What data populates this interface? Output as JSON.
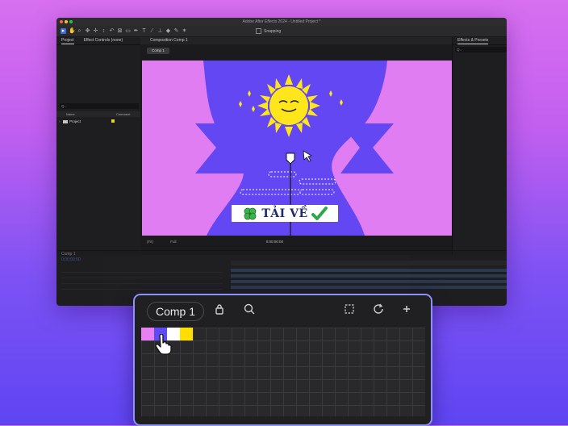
{
  "window": {
    "title": "Adobe After Effects 2024 - Untitled Project *"
  },
  "toolbar": {
    "snapping_label": "Snapping"
  },
  "project_panel": {
    "tabs": [
      "Project",
      "Effect Controls (none)"
    ],
    "search_placeholder": "Q⌵",
    "columns": {
      "name": "Name",
      "comment": "Comment"
    },
    "item": "Project"
  },
  "viewer": {
    "tab_label": "Composition Comp 1",
    "comp_pill": "Comp 1",
    "zoom": "(Fit)",
    "resolution": "Full",
    "timecode": "0:00:00:00"
  },
  "effects_panel": {
    "tab_label": "Effects & Presets",
    "search_placeholder": "Q⌵"
  },
  "timeline": {
    "tab_label": "Comp 1",
    "timecode": "0;00;00;00"
  },
  "canvas": {
    "badge_text": "TẢI VỀ",
    "colors": {
      "background": "#e17df3",
      "shape": "#6247f2",
      "sun": "#ffe61a",
      "badge_bg": "#ffffff"
    }
  },
  "popup": {
    "comp_label": "Comp 1",
    "icons": [
      "lock-icon",
      "search-icon",
      "crop-icon",
      "refresh-icon",
      "plus-icon"
    ],
    "swatches": [
      "#e781f3",
      "#5f4bf6",
      "#ffffff",
      "#ffde00"
    ]
  }
}
